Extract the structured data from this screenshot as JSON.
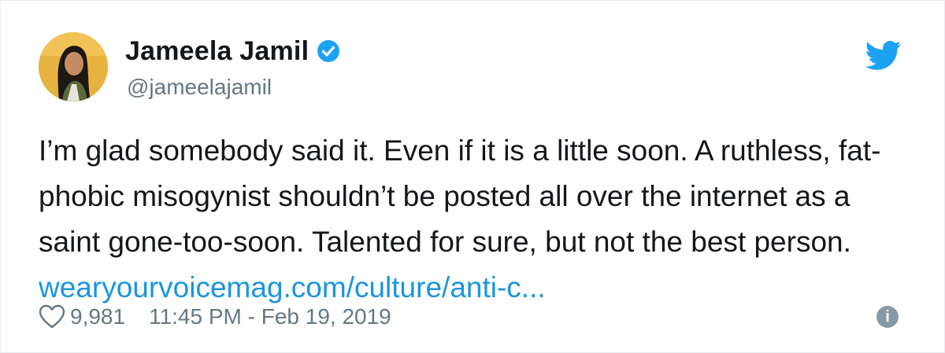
{
  "tweet": {
    "author": {
      "display_name": "Jameela Jamil",
      "handle": "@jameelajamil",
      "verified": true
    },
    "text": "I’m glad somebody said it. Even if it is a little soon. A ruthless, fat-phobic misogynist shouldn’t be posted all over the internet as a saint gone-too-soon. Talented for sure, but not the best person.",
    "link_text": "wearyourvoicemag.com/culture/anti-c...",
    "likes": "9,981",
    "timestamp": "11:45 PM - Feb 19, 2019"
  },
  "colors": {
    "text": "#14171a",
    "secondary": "#657786",
    "link": "#1b95e0",
    "brand": "#1da1f2",
    "info_icon": "#8899a6"
  },
  "icons": {
    "verified": "verified-badge-icon",
    "logo": "twitter-bird-icon",
    "like": "heart-icon",
    "info": "info-icon"
  }
}
